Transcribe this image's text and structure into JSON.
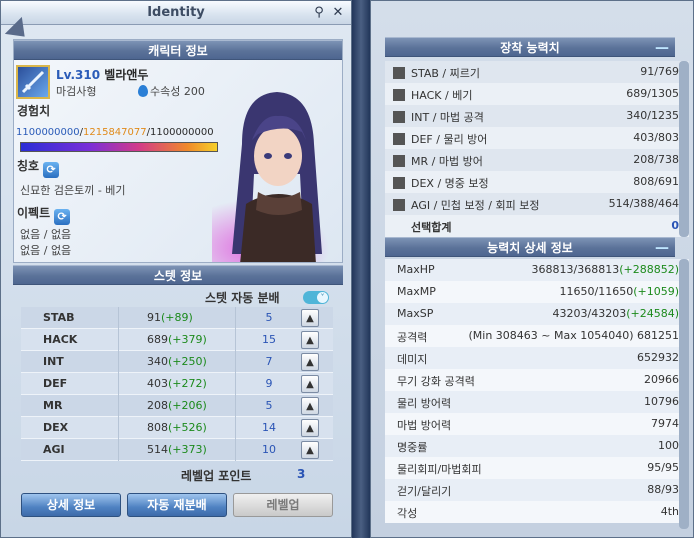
{
  "window": {
    "title": "Identity"
  },
  "char_info": {
    "header": "캐릭터 정보",
    "level_prefix": "Lv.310",
    "name": "벨라앤두",
    "class": "마검사형",
    "element": "수속성 200",
    "exp_label": "경험치",
    "exp_seg1": "1100000000",
    "exp_seg2": "1215847077",
    "exp_seg3": "1100000000",
    "title_label": "칭호",
    "title_value": "신묘한 검은토끼 - 베기",
    "effect_label": "이펙트",
    "effect_line1": "없음 / 없음",
    "effect_line2": "없음 / 없음"
  },
  "stat_info": {
    "header": "스텟 정보",
    "auto_label": "스텟 자동 분배",
    "rows": [
      {
        "name": "STAB",
        "base": "91",
        "bonus": "(+89)",
        "points": "5"
      },
      {
        "name": "HACK",
        "base": "689",
        "bonus": "(+379)",
        "points": "15"
      },
      {
        "name": "INT",
        "base": "340",
        "bonus": "(+250)",
        "points": "7"
      },
      {
        "name": "DEF",
        "base": "403",
        "bonus": "(+272)",
        "points": "9"
      },
      {
        "name": "MR",
        "base": "208",
        "bonus": "(+206)",
        "points": "5"
      },
      {
        "name": "DEX",
        "base": "808",
        "bonus": "(+526)",
        "points": "14"
      },
      {
        "name": "AGI",
        "base": "514",
        "bonus": "(+373)",
        "points": "10"
      }
    ],
    "levelup_points_label": "레벨업 포인트",
    "levelup_points": "3"
  },
  "buttons": {
    "detail": "상세 정보",
    "auto_redistribute": "자동 재분배",
    "levelup": "레벨업"
  },
  "equip_stats": {
    "header": "장착 능력치",
    "rows": [
      {
        "k": "STAB / 찌르기",
        "v": "91/769"
      },
      {
        "k": "HACK / 베기",
        "v": "689/1305"
      },
      {
        "k": "INT / 마법 공격",
        "v": "340/1235"
      },
      {
        "k": "DEF / 물리 방어",
        "v": "403/803"
      },
      {
        "k": "MR / 마법 방어",
        "v": "208/738"
      },
      {
        "k": "DEX / 명중 보정",
        "v": "808/691"
      },
      {
        "k": "AGI / 민첩 보정 / 회피 보정",
        "v": "514/388/464"
      }
    ],
    "select_total_label": "선택합계",
    "select_total": "0"
  },
  "detail_stats": {
    "header": "능력치 상세 정보",
    "rows": [
      {
        "k": "MaxHP",
        "v": "368813/368813",
        "g": "(+288852)"
      },
      {
        "k": "MaxMP",
        "v": "11650/11650",
        "g": "(+1059)"
      },
      {
        "k": "MaxSP",
        "v": "43203/43203",
        "g": "(+24584)"
      },
      {
        "k": "공격력",
        "v": "(Min 308463 ~ Max 1054040)  681251",
        "g": ""
      },
      {
        "k": "데미지",
        "v": "652932",
        "g": ""
      },
      {
        "k": "무기 강화 공격력",
        "v": "20966",
        "g": ""
      },
      {
        "k": "물리 방어력",
        "v": "10796",
        "g": ""
      },
      {
        "k": "마법 방어력",
        "v": "7974",
        "g": ""
      },
      {
        "k": "명중률",
        "v": "100",
        "g": ""
      },
      {
        "k": "물리회피/마법회피",
        "v": "95/95",
        "g": ""
      },
      {
        "k": "걷기/달리기",
        "v": "88/93",
        "g": ""
      },
      {
        "k": "각성",
        "v": "4th",
        "g": ""
      }
    ]
  }
}
